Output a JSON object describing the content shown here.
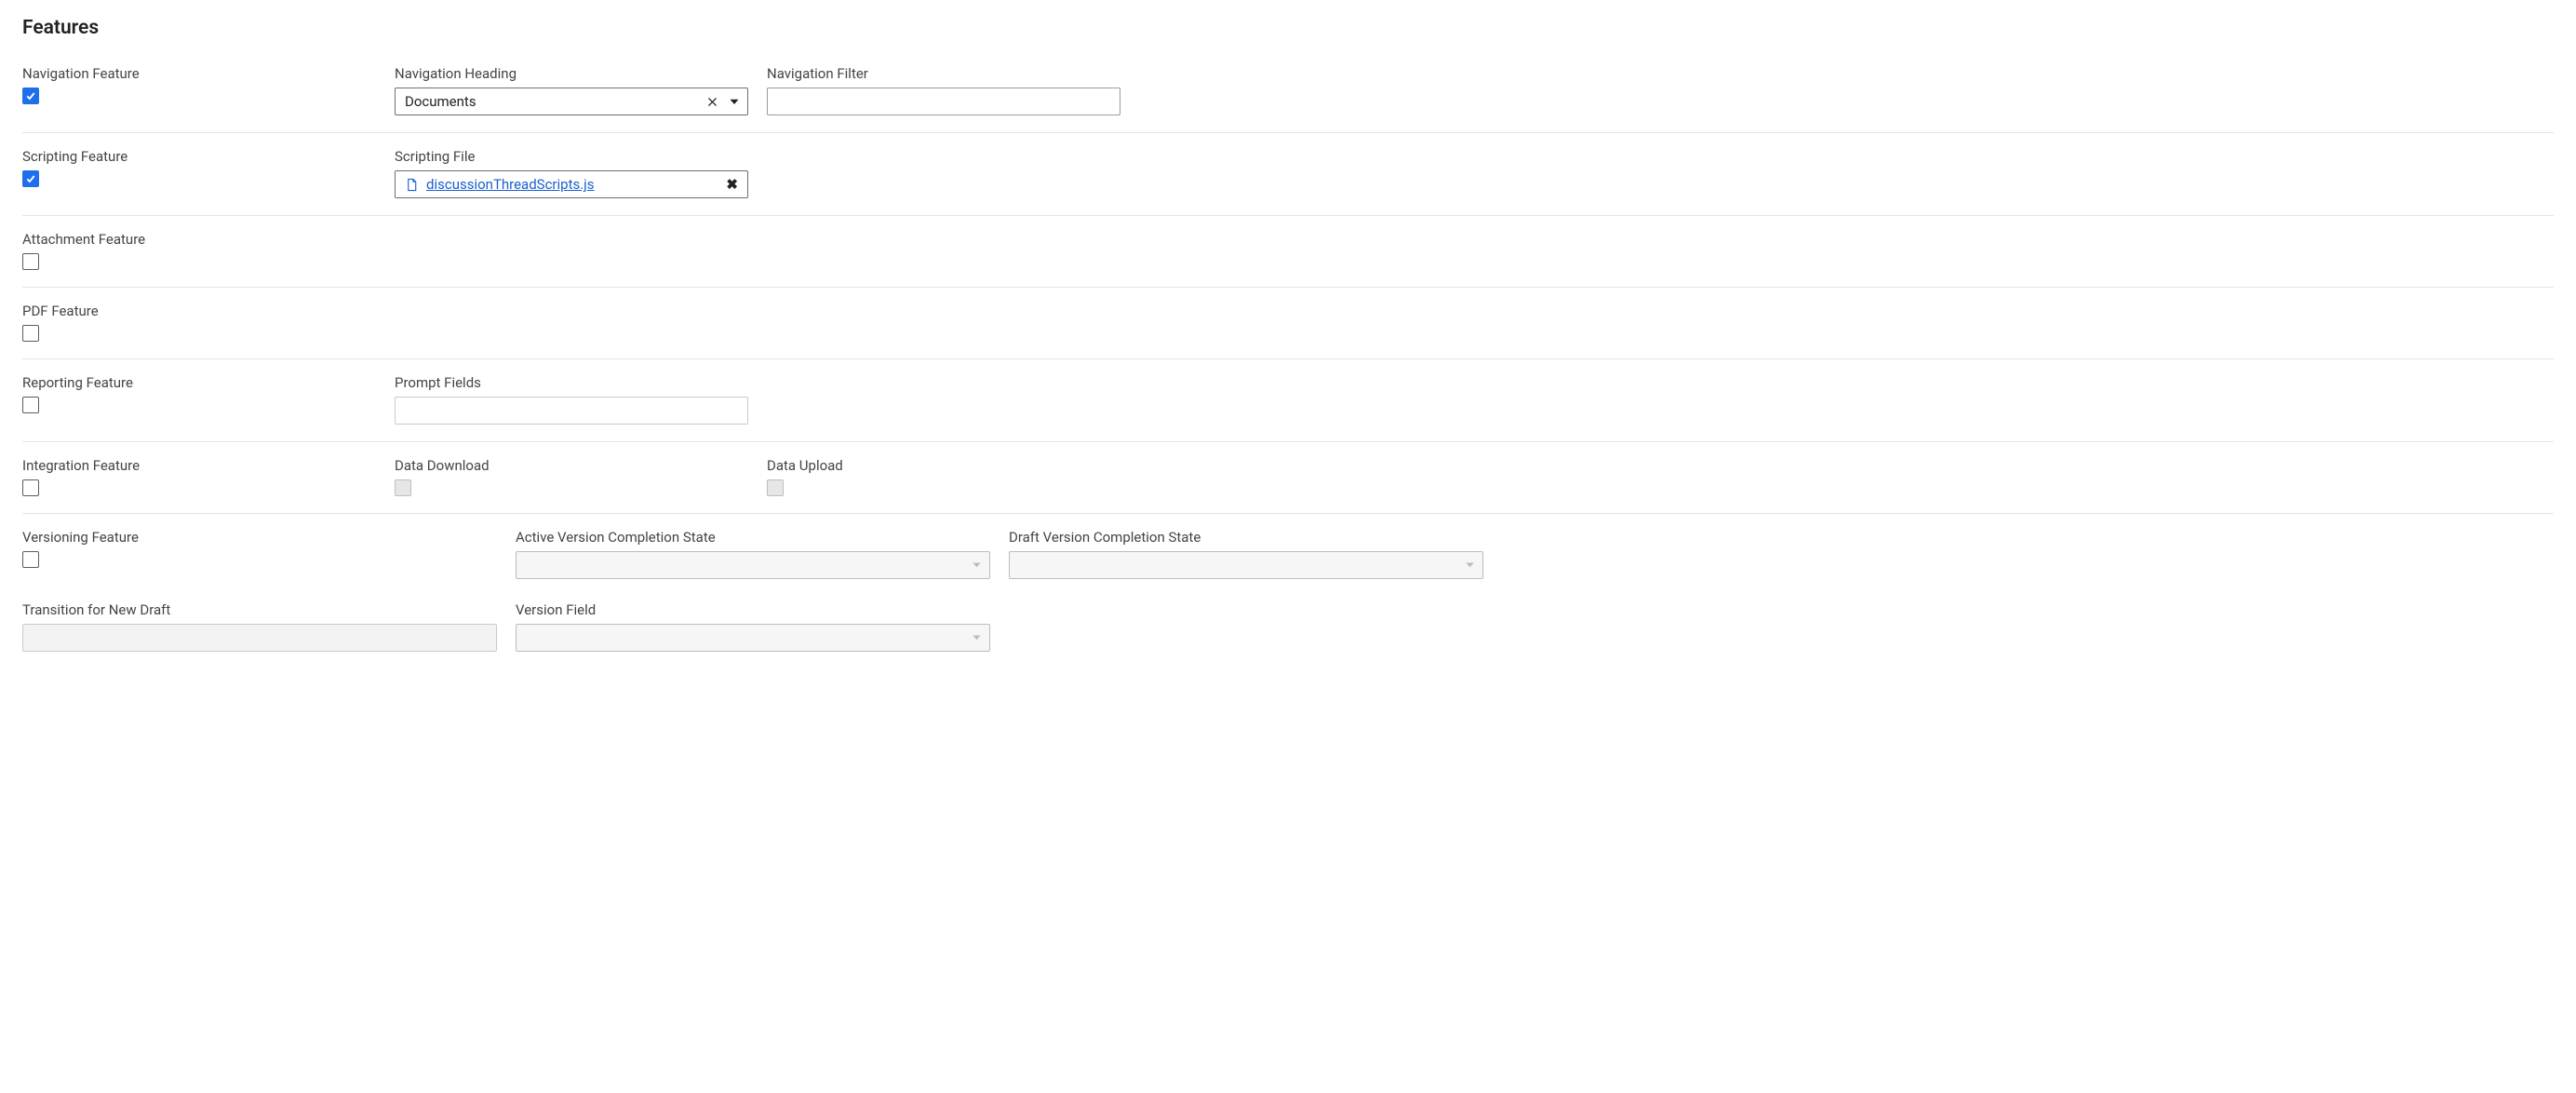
{
  "section_title": "Features",
  "navigation": {
    "feature_label": "Navigation Feature",
    "feature_checked": true,
    "heading_label": "Navigation Heading",
    "heading_value": "Documents",
    "filter_label": "Navigation Filter",
    "filter_value": ""
  },
  "scripting": {
    "feature_label": "Scripting Feature",
    "feature_checked": true,
    "file_label": "Scripting File",
    "file_name": "discussionThreadScripts.js"
  },
  "attachment": {
    "feature_label": "Attachment Feature",
    "feature_checked": false
  },
  "pdf": {
    "feature_label": "PDF Feature",
    "feature_checked": false
  },
  "reporting": {
    "feature_label": "Reporting Feature",
    "feature_checked": false,
    "prompt_label": "Prompt Fields",
    "prompt_value": ""
  },
  "integration": {
    "feature_label": "Integration Feature",
    "feature_checked": false,
    "download_label": "Data Download",
    "upload_label": "Data Upload"
  },
  "versioning": {
    "feature_label": "Versioning Feature",
    "feature_checked": false,
    "active_label": "Active Version Completion State",
    "active_value": "",
    "draft_label": "Draft Version Completion State",
    "draft_value": "",
    "transition_label": "Transition for New Draft",
    "transition_value": "",
    "version_field_label": "Version Field",
    "version_field_value": ""
  }
}
